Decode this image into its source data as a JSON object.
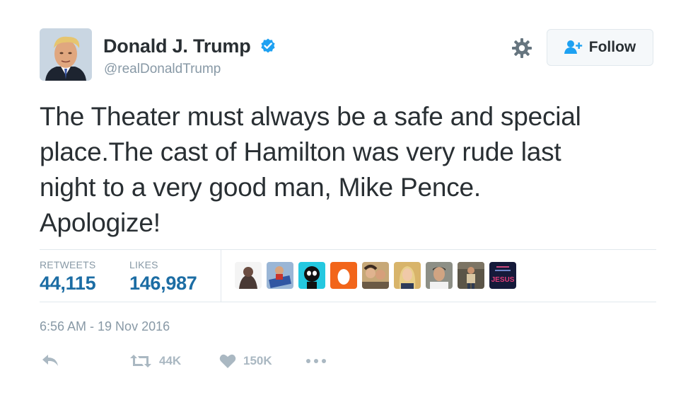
{
  "user": {
    "name": "Donald J. Trump",
    "handle": "@realDonaldTrump",
    "verified": true
  },
  "header": {
    "follow_label": "Follow"
  },
  "tweet": {
    "text": "The Theater must always be a safe and special\nplace.The cast of Hamilton was very rude last\nnight to a very good man, Mike Pence.\nApologize!"
  },
  "stats": {
    "retweets_label": "RETWEETS",
    "retweets_value": "44,115",
    "likes_label": "LIKES",
    "likes_value": "146,987"
  },
  "likers": [
    {
      "icon": "liker-avatar"
    },
    {
      "icon": "liker-avatar"
    },
    {
      "icon": "liker-avatar"
    },
    {
      "icon": "liker-avatar-egg"
    },
    {
      "icon": "liker-avatar"
    },
    {
      "icon": "liker-avatar"
    },
    {
      "icon": "liker-avatar"
    },
    {
      "icon": "liker-avatar"
    },
    {
      "icon": "liker-avatar-jesus",
      "text": "JESUS"
    }
  ],
  "timestamp": "6:56 AM - 19 Nov 2016",
  "actions": {
    "retweet_count": "44K",
    "like_count": "150K"
  },
  "colors": {
    "text": "#292f33",
    "muted": "#8899a6",
    "link_blue": "#1c6da4",
    "verified_blue": "#1da1f2",
    "egg_orange": "#f2651a"
  }
}
